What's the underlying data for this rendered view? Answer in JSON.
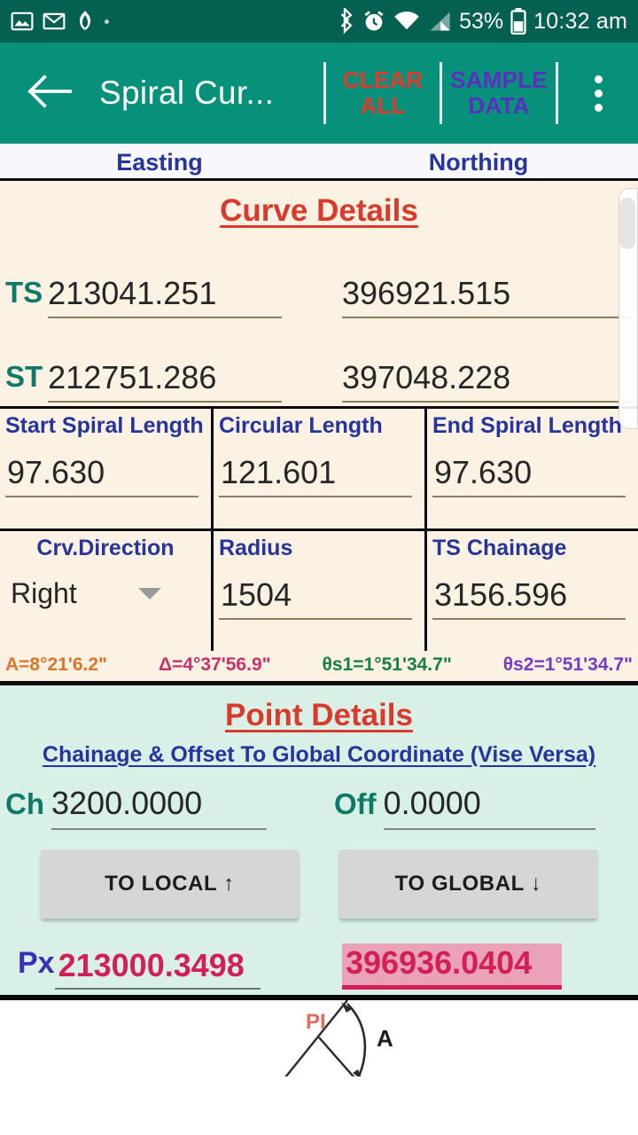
{
  "status_bar": {
    "icons_left": [
      "photos-icon",
      "gmail-icon",
      "app-icon",
      "dot-icon"
    ],
    "icons_right": [
      "bluetooth-icon",
      "alarm-icon",
      "wifi-icon",
      "signal-icon"
    ],
    "battery_percent": "53%",
    "battery_icon": "battery-icon",
    "time": "10:32 am"
  },
  "app_bar": {
    "back_icon": "back-arrow-icon",
    "title": "Spiral Cur...",
    "clear_all": "CLEAR\nALL",
    "clear_all_line1": "CLEAR",
    "clear_all_line2": "ALL",
    "sample_data_line1": "SAMPLE",
    "sample_data_line2": "DATA",
    "overflow_icon": "overflow-menu-icon",
    "bg_color": "#07917a",
    "clear_color": "#e23b2e",
    "sample_color": "#5b2fbf"
  },
  "column_headers": {
    "easting": "Easting",
    "northing": "Northing"
  },
  "curve_details": {
    "title": "Curve Details",
    "rows": [
      {
        "label": "TS",
        "easting": "213041.251",
        "northing": "396921.515"
      },
      {
        "label": "ST",
        "easting": "212751.286",
        "northing": "397048.228"
      }
    ],
    "lengths": [
      {
        "label": "Start Spiral Length",
        "value": "97.630"
      },
      {
        "label": "Circular Length",
        "value": "121.601"
      },
      {
        "label": "End Spiral Length",
        "value": "97.630"
      }
    ],
    "params": [
      {
        "label": "Crv.Direction",
        "value": "Right",
        "type": "dropdown"
      },
      {
        "label": "Radius",
        "value": "1504",
        "type": "input"
      },
      {
        "label": "TS Chainage",
        "value": "3156.596",
        "type": "input"
      }
    ],
    "angles": [
      {
        "name": "A",
        "text": "A=8°21'6.2\"",
        "color": "#e0752a"
      },
      {
        "name": "Delta",
        "text": "Δ=4°37'56.9\"",
        "color": "#c9316b"
      },
      {
        "name": "theta-s1",
        "text": "θs1=1°51'34.7\"",
        "color": "#17823f"
      },
      {
        "name": "theta-s2",
        "text": "θs2=1°51'34.7\"",
        "color": "#7a3bc4"
      }
    ],
    "title_color": "#d93a2b",
    "bg_color": "#fbf2e3"
  },
  "point_details": {
    "title": "Point Details",
    "subtitle": "Chainage & Offset To Global Coordinate (Vise Versa)",
    "chainage_label": "Ch",
    "chainage_value": "3200.0000",
    "offset_label": "Off",
    "offset_value": "0.0000",
    "to_local_button": "TO LOCAL ↑",
    "to_global_button": "TO GLOBAL ↓",
    "px_label": "Px",
    "px_easting": "213000.3498",
    "px_northing": "396936.0404",
    "bg_color": "#d9f0e6",
    "value_color": "#d31f57",
    "highlight_color": "#eaa2b8"
  },
  "diagram": {
    "pi_label": "PI",
    "a_label": "A"
  }
}
